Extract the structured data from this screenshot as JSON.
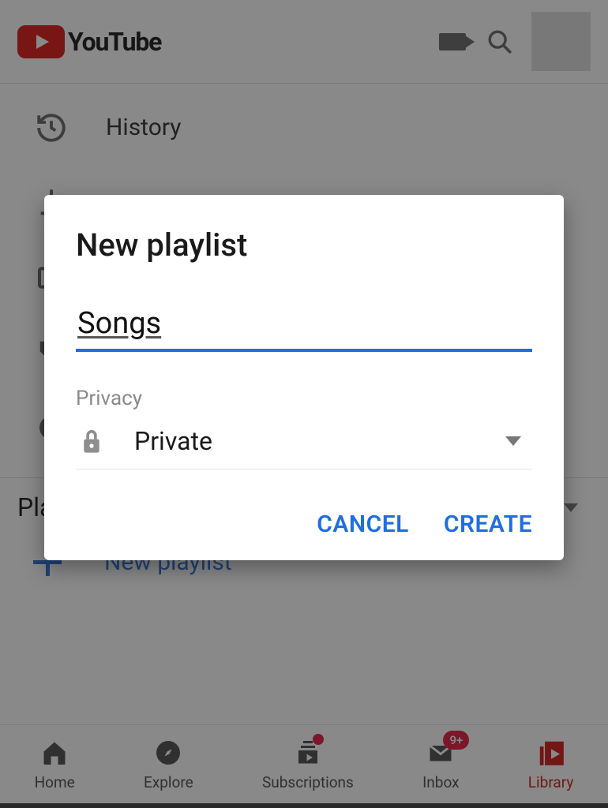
{
  "header": {
    "brand": "YouTube"
  },
  "library": {
    "rows": [
      {
        "label": "History"
      }
    ],
    "section_title": "Playlists",
    "new_playlist_label": "New playlist"
  },
  "bottomnav": {
    "items": [
      {
        "label": "Home"
      },
      {
        "label": "Explore"
      },
      {
        "label": "Subscriptions"
      },
      {
        "label": "Inbox",
        "badge": "9+"
      },
      {
        "label": "Library"
      }
    ]
  },
  "dialog": {
    "title": "New playlist",
    "title_value": "Songs",
    "privacy_label": "Privacy",
    "privacy_value": "Private",
    "cancel": "CANCEL",
    "create": "CREATE"
  }
}
